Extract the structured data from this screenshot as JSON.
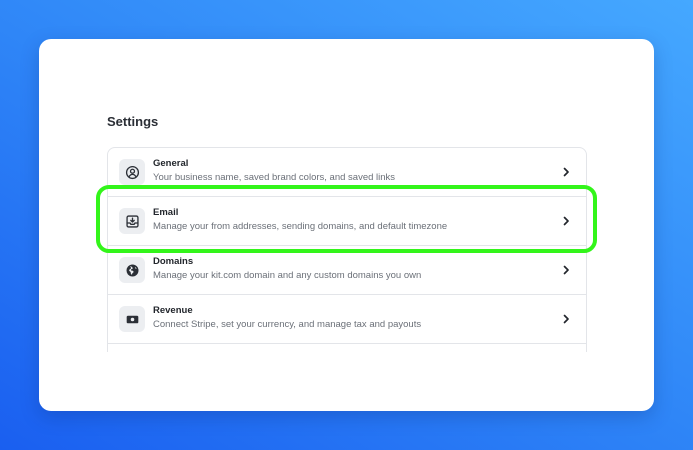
{
  "page": {
    "title": "Settings"
  },
  "settings_items": [
    {
      "title": "General",
      "description": "Your business name, saved brand colors, and saved links",
      "icon": "user-circle-icon"
    },
    {
      "title": "Email",
      "description": "Manage your from addresses, sending domains, and default timezone",
      "icon": "inbox-download-icon"
    },
    {
      "title": "Domains",
      "description": "Manage your kit.com domain and any custom domains you own",
      "icon": "globe-icon"
    },
    {
      "title": "Revenue",
      "description": "Connect Stripe, set your currency, and manage tax and payouts",
      "icon": "banknote-icon"
    }
  ],
  "colors": {
    "highlight": "#33f51a",
    "background_gradient_start": "#1a5ff0",
    "background_gradient_end": "#45a8ff"
  }
}
